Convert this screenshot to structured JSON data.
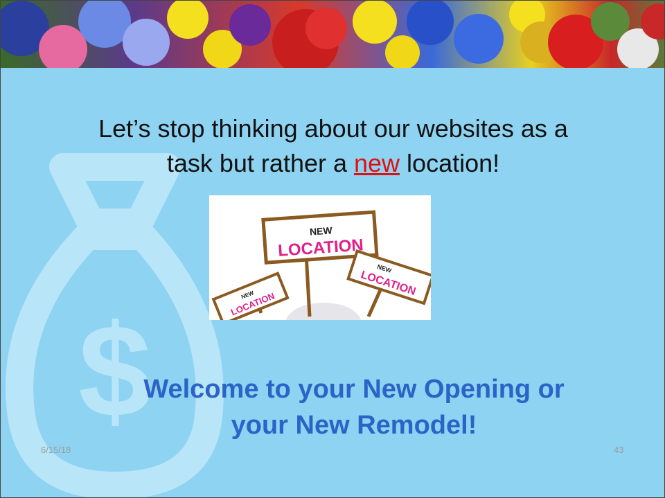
{
  "slide": {
    "headline": {
      "part1": "Let’s stop thinking about our websites as a",
      "part2": "task but rather a ",
      "emphasis": "new",
      "part3": " location!"
    },
    "image": {
      "sign_main_line1": "NEW",
      "sign_main_line2": "LOCATION",
      "sign_right_line1": "NEW",
      "sign_right_line2": "LOCATION",
      "sign_left_line1": "NEW",
      "sign_left_line2": "LOCATION"
    },
    "welcome": {
      "line1": "Welcome to your New Opening or",
      "line2": "your New Remodel!"
    },
    "footer": {
      "date": "6/15/18",
      "page_number": "43"
    }
  },
  "colors": {
    "background": "#8fd3f2",
    "welcome_text": "#2b63c6",
    "emphasis": "#e01010"
  }
}
